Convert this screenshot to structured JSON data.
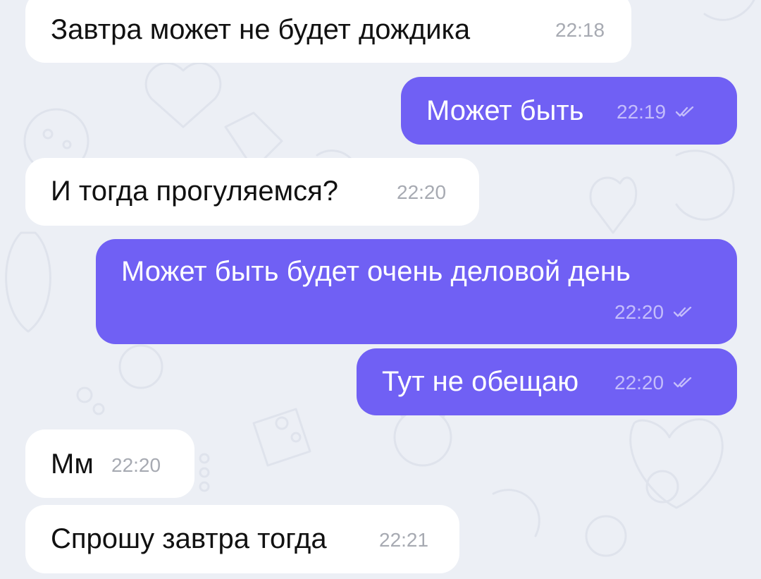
{
  "theme": {
    "background": "#eceff5",
    "incoming_bubble": "#ffffff",
    "outgoing_bubble": "#7060f4",
    "incoming_time": "#a7aab2",
    "outgoing_time": "#c4bdfb"
  },
  "messages": [
    {
      "direction": "incoming",
      "text": "Завтра может не будет дождика",
      "time": "22:18"
    },
    {
      "direction": "outgoing",
      "text": "Может быть",
      "time": "22:19",
      "status": "read-double-check-icon"
    },
    {
      "direction": "incoming",
      "text": "И тогда прогуляемся?",
      "time": "22:20"
    },
    {
      "direction": "outgoing",
      "text": "Может быть будет очень деловой день",
      "time": "22:20",
      "status": "read-double-check-icon"
    },
    {
      "direction": "outgoing",
      "text": "Тут не обещаю",
      "time": "22:20",
      "status": "read-double-check-icon"
    },
    {
      "direction": "incoming",
      "text": "Мм",
      "time": "22:20"
    },
    {
      "direction": "incoming",
      "text": "Спрошу завтра тогда",
      "time": "22:21"
    }
  ]
}
